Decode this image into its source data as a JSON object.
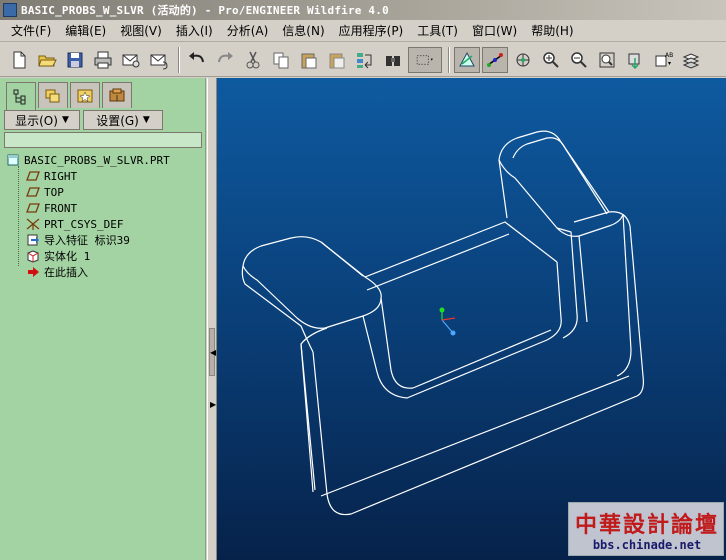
{
  "window": {
    "title": "BASIC_PROBS_W_SLVR (活动的) - Pro/ENGINEER Wildfire 4.0"
  },
  "menu": [
    {
      "label": "文件(F)"
    },
    {
      "label": "编辑(E)"
    },
    {
      "label": "视图(V)"
    },
    {
      "label": "插入(I)"
    },
    {
      "label": "分析(A)"
    },
    {
      "label": "信息(N)"
    },
    {
      "label": "应用程序(P)"
    },
    {
      "label": "工具(T)"
    },
    {
      "label": "窗口(W)"
    },
    {
      "label": "帮助(H)"
    }
  ],
  "toolbar": {
    "icons": [
      "new-file-icon",
      "open-folder-icon",
      "save-icon",
      "print-icon",
      "send-mail-icon",
      "mail-attach-icon",
      "undo-icon",
      "redo-icon",
      "cut-icon",
      "copy-icon",
      "paste-icon",
      "paste-special-icon",
      "regenerate-icon",
      "find-icon",
      "select-box-icon",
      "datum-display-icon",
      "datum-axis-icon",
      "spin-center-icon",
      "zoom-in-icon",
      "zoom-out-icon",
      "refit-icon",
      "orient-icon",
      "saved-views-icon",
      "layers-icon"
    ]
  },
  "panel": {
    "tabs": [
      "model-tree-tab",
      "folder-browser-tab",
      "favorites-tab",
      "connections-tab"
    ],
    "show_button": "显示(O)",
    "settings_button": "设置(G)"
  },
  "tree": {
    "root": "BASIC_PROBS_W_SLVR.PRT",
    "items": [
      {
        "label": "RIGHT",
        "icon": "datum-plane-icon"
      },
      {
        "label": "TOP",
        "icon": "datum-plane-icon"
      },
      {
        "label": "FRONT",
        "icon": "datum-plane-icon"
      },
      {
        "label": "PRT_CSYS_DEF",
        "icon": "coordinate-system-icon"
      },
      {
        "label": "导入特征 标识39",
        "icon": "import-feature-icon"
      },
      {
        "label": "实体化 1",
        "icon": "solidify-icon"
      },
      {
        "label": "在此插入",
        "icon": "insert-here-arrow-icon"
      }
    ]
  },
  "watermark": {
    "title": "中華設計論壇",
    "url": "bbs.chinade.net"
  },
  "colors": {
    "panel_bg": "#a3d3a3",
    "viewport_top": "#0e5aa0",
    "viewport_bottom": "#06224a",
    "model_edge": "#ffffff",
    "toolbar_bg": "#d4d0c8"
  }
}
